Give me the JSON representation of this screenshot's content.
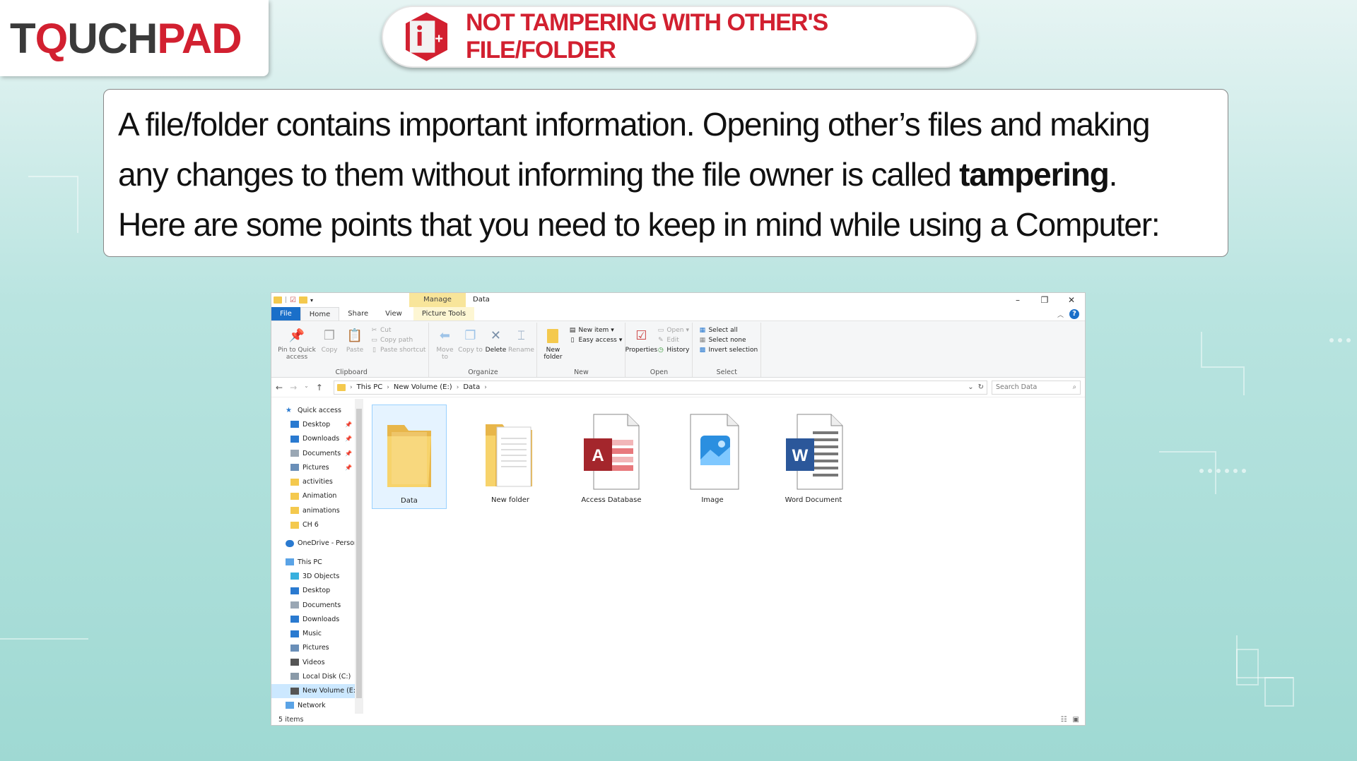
{
  "logo": {
    "part1": "T",
    "part2": "Q",
    "part3": "UCH",
    "part4": "PAD"
  },
  "header": {
    "title": "NOT TAMPERING WITH OTHER'S FILE/FOLDER"
  },
  "intro": {
    "line1": "A file/folder contains important information. Opening other’s files and making",
    "line2_pre": "any changes to them without informing the file owner is called ",
    "line2_bold": "tampering",
    "line2_post": ".",
    "line3": "Here are some points that you need to keep in mind while using a Computer:"
  },
  "explorer": {
    "window_title": "Data",
    "manage_tab": "Manage",
    "controls": {
      "minimize": "–",
      "restore": "❐",
      "close": "✕"
    },
    "tabs": {
      "file": "File",
      "home": "Home",
      "share": "Share",
      "view": "View",
      "picture_tools": "Picture Tools"
    },
    "ribbon": {
      "clipboard": {
        "label": "Clipboard",
        "pin": "Pin to Quick access",
        "copy": "Copy",
        "paste": "Paste",
        "cut": "Cut",
        "copy_path": "Copy path",
        "paste_shortcut": "Paste shortcut"
      },
      "organize": {
        "label": "Organize",
        "move_to": "Move to",
        "copy_to": "Copy to",
        "delete": "Delete",
        "rename": "Rename"
      },
      "new": {
        "label": "New",
        "new_folder": "New folder",
        "new_item": "New item",
        "easy_access": "Easy access"
      },
      "open": {
        "label": "Open",
        "properties": "Properties",
        "open": "Open",
        "edit": "Edit",
        "history": "History"
      },
      "select": {
        "label": "Select",
        "select_all": "Select all",
        "select_none": "Select none",
        "invert_selection": "Invert selection"
      }
    },
    "address": {
      "crumbs": [
        "This PC",
        "New Volume (E:)",
        "Data"
      ],
      "search_placeholder": "Search Data"
    },
    "nav": {
      "quick_access": "Quick access",
      "qa_items": [
        "Desktop",
        "Downloads",
        "Documents",
        "Pictures",
        "activities",
        "Animation",
        "animations",
        "CH 6"
      ],
      "onedrive": "OneDrive - Persor",
      "this_pc": "This PC",
      "pc_items": [
        "3D Objects",
        "Desktop",
        "Documents",
        "Downloads",
        "Music",
        "Pictures",
        "Videos",
        "Local Disk (C:)",
        "New Volume (E:)"
      ],
      "network": "Network"
    },
    "files": [
      {
        "name": "Data",
        "icon": "folder-icon"
      },
      {
        "name": "New folder",
        "icon": "folder-with-documents-icon"
      },
      {
        "name": "Access Database",
        "icon": "access-file-icon"
      },
      {
        "name": "Image",
        "icon": "image-file-icon"
      },
      {
        "name": "Word Document",
        "icon": "word-file-icon"
      }
    ],
    "status": {
      "item_count": "5 items"
    }
  }
}
